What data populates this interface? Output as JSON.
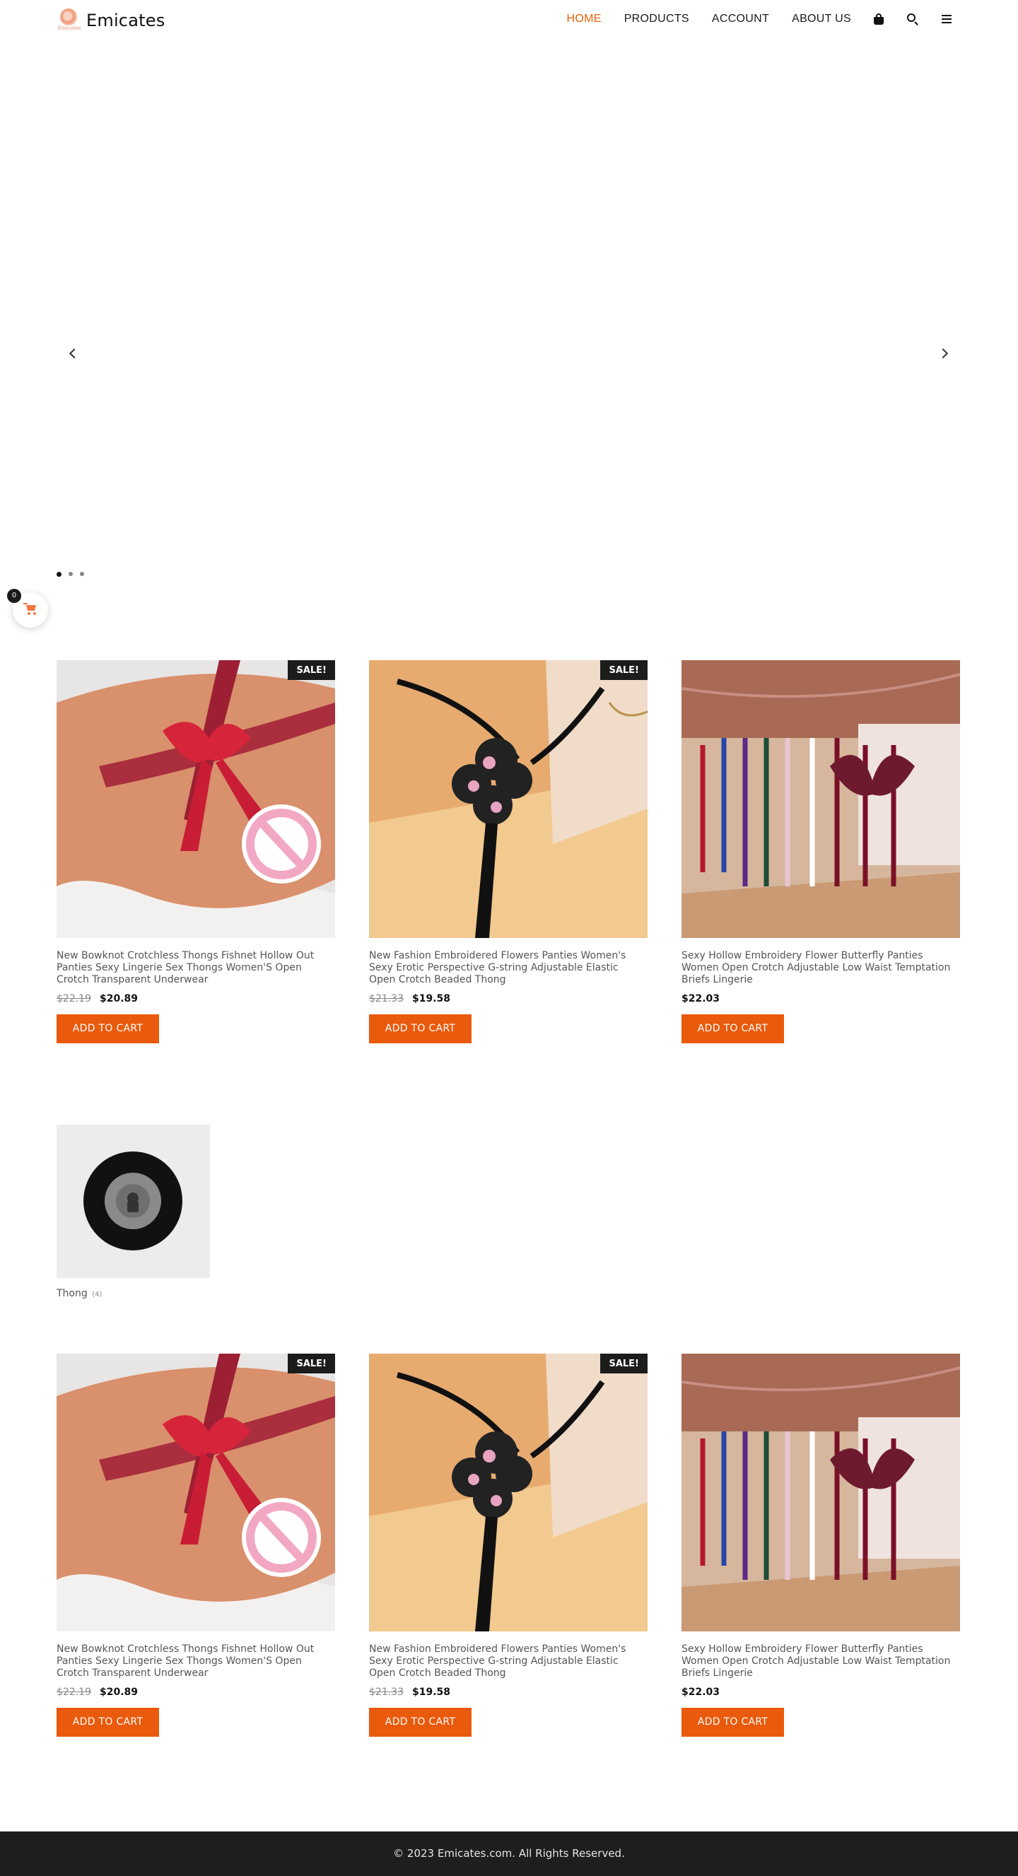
{
  "header": {
    "brand": "Emicates",
    "logo_script": "Emicates",
    "nav": [
      {
        "label": "HOME",
        "active": true
      },
      {
        "label": "PRODUCTS",
        "active": false
      },
      {
        "label": "ACCOUNT",
        "active": false
      },
      {
        "label": "ABOUT US",
        "active": false
      }
    ],
    "icons": [
      "cart-bag-icon",
      "search-icon",
      "menu-icon"
    ]
  },
  "slider": {
    "slides_count": 3,
    "active_slide": 1
  },
  "floating_cart": {
    "count": "0"
  },
  "products_top": [
    {
      "title": "New Bowknot Crotchless Thongs Fishnet Hollow Out Panties Sexy Lingerie Sex Thongs Women'S Open Crotch Transparent Underwear",
      "old_price": "$22.19",
      "price": "$20.89",
      "sale": "SALE!",
      "button": "ADD TO CART"
    },
    {
      "title": "New Fashion Embroidered Flowers Panties Women's Sexy Erotic Perspective G-string Adjustable Elastic Open Crotch Beaded Thong",
      "old_price": "$21.33",
      "price": "$19.58",
      "sale": "SALE!",
      "button": "ADD TO CART"
    },
    {
      "title": "Sexy Hollow Embroidery Flower Butterfly Panties Women Open Crotch Adjustable Low Waist Temptation Briefs Lingerie",
      "old_price": "",
      "price": "$22.03",
      "sale": "",
      "button": "ADD TO CART"
    }
  ],
  "category": {
    "name": "Thong",
    "count": "(4)"
  },
  "products_bottom": [
    {
      "title": "New Bowknot Crotchless Thongs Fishnet Hollow Out Panties Sexy Lingerie Sex Thongs Women'S Open Crotch Transparent Underwear",
      "old_price": "$22.19",
      "price": "$20.89",
      "sale": "SALE!",
      "button": "ADD TO CART"
    },
    {
      "title": "New Fashion Embroidered Flowers Panties Women's Sexy Erotic Perspective G-string Adjustable Elastic Open Crotch Beaded Thong",
      "old_price": "$21.33",
      "price": "$19.58",
      "sale": "SALE!",
      "button": "ADD TO CART"
    },
    {
      "title": "Sexy Hollow Embroidery Flower Butterfly Panties Women Open Crotch Adjustable Low Waist Temptation Briefs Lingerie",
      "old_price": "",
      "price": "$22.03",
      "sale": "",
      "button": "ADD TO CART"
    }
  ],
  "footer": {
    "copyright": "© 2023 Emicates.com. All Rights Reserved."
  },
  "colors": {
    "accent": "#ea5a0c",
    "nav_active": "#e8620a",
    "footer_bg": "#1e1e1e",
    "sale_badge": "#1c1c1c"
  }
}
